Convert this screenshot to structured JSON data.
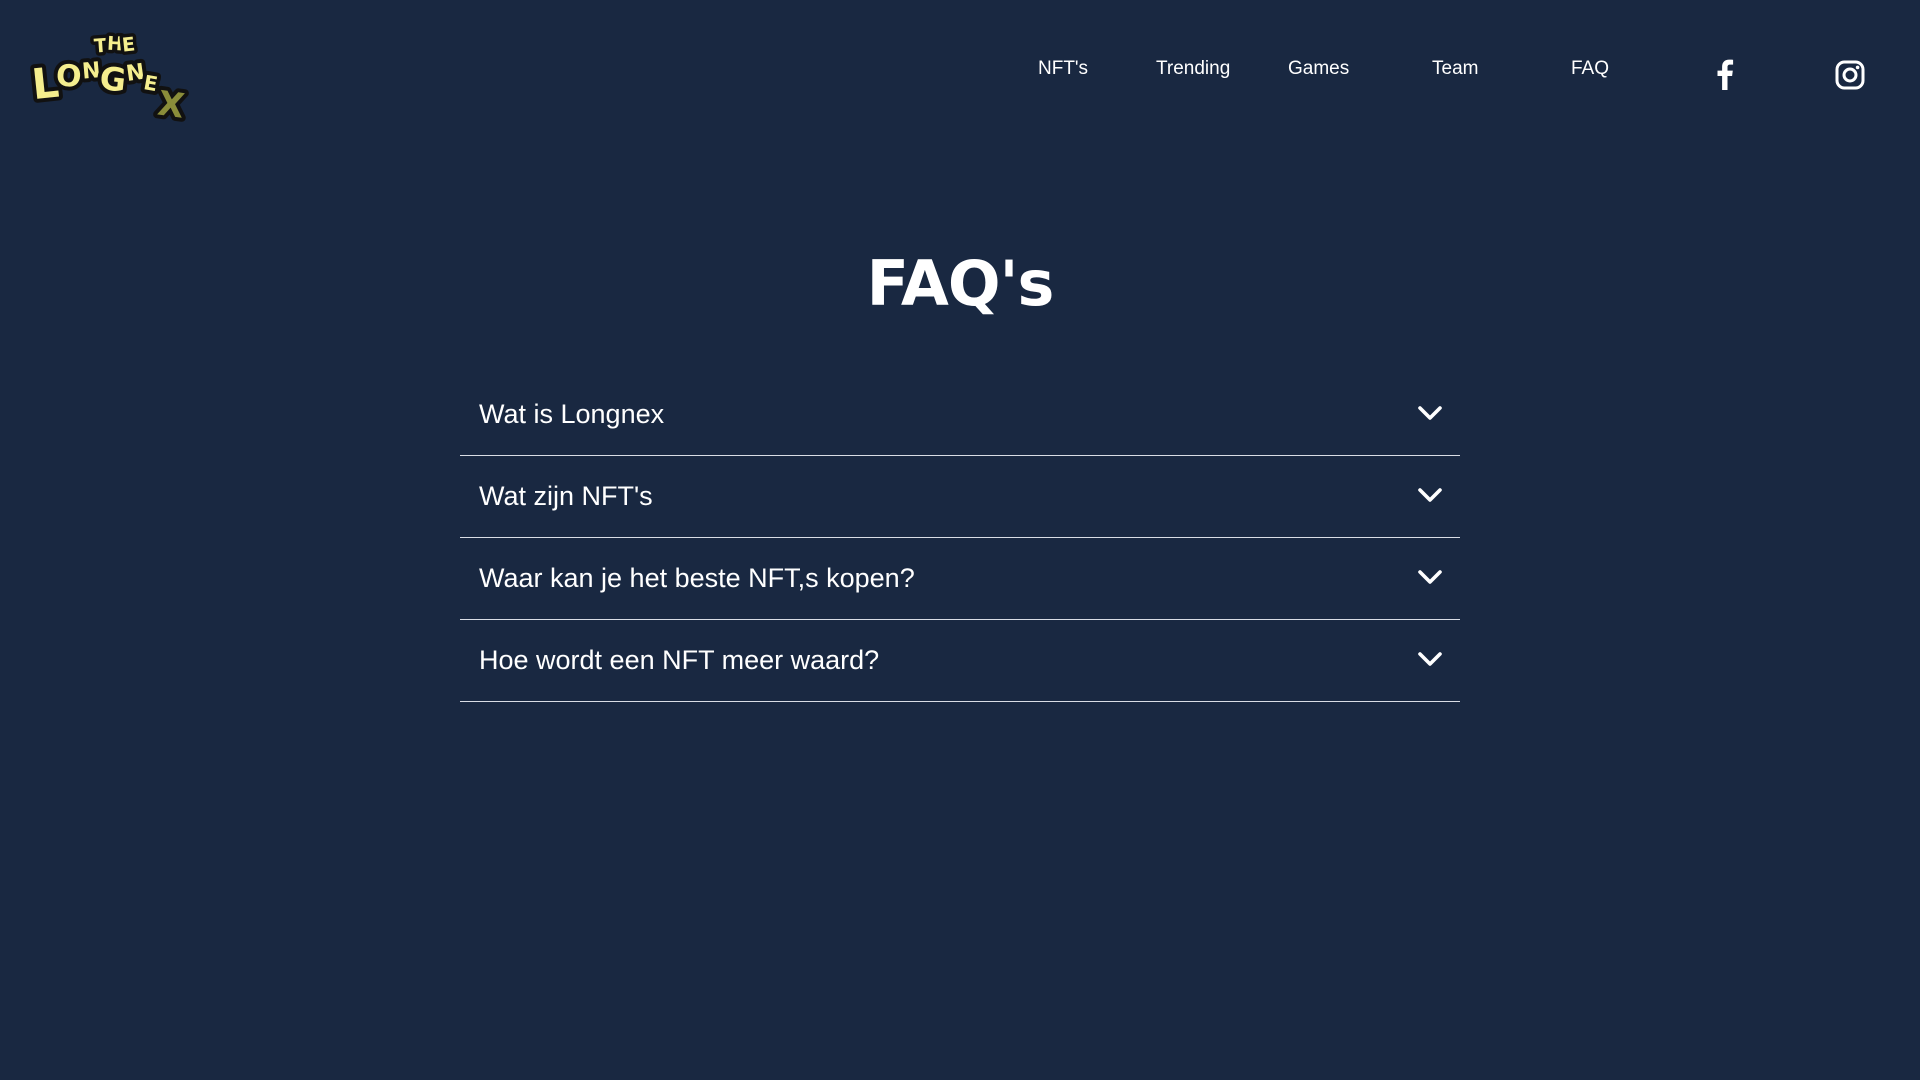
{
  "brand": {
    "logo_word_top": "THE",
    "logo_word_main": "LONGNEX",
    "logo_alt": "The Longnex logo"
  },
  "nav": {
    "items": [
      {
        "label": "NFT's"
      },
      {
        "label": "Trending"
      },
      {
        "label": "Games"
      },
      {
        "label": "Team"
      },
      {
        "label": "FAQ"
      }
    ],
    "social": [
      {
        "icon": "facebook-icon"
      },
      {
        "icon": "instagram-icon"
      }
    ]
  },
  "main": {
    "title": "FAQ's",
    "faq": [
      {
        "question": "Wat is Longnex"
      },
      {
        "question": "Wat zijn NFT's"
      },
      {
        "question": "Waar kan je het beste NFT,s kopen?"
      },
      {
        "question": "Hoe wordt een NFT meer waard?"
      }
    ]
  },
  "colors": {
    "background": "#192841",
    "text": "#ffffff",
    "divider": "#d9dde5",
    "logo_yellow": "#f5ee8e",
    "logo_olive": "#8a8d3a"
  }
}
